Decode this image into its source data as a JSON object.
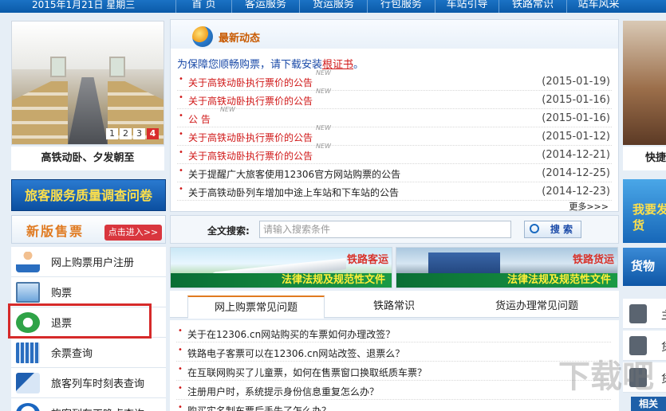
{
  "topbar": {
    "date": "2015年1月21日 星期三",
    "nav": [
      "首 页",
      "客运服务",
      "货运服务",
      "行包服务",
      "车站引导",
      "铁路常识",
      "站车风采"
    ]
  },
  "slider": {
    "pages": [
      "1",
      "2",
      "3",
      "4"
    ],
    "active_page": "4",
    "caption": "高铁动卧、夕发朝至"
  },
  "survey_banner": "旅客服务质量调查问卷",
  "new_ticket": {
    "title": "新版售票",
    "enter": "点击进入>>"
  },
  "left_menu": [
    {
      "label": "网上购票用户注册",
      "icon": "user-register-icon"
    },
    {
      "label": "购票",
      "icon": "computer-icon"
    },
    {
      "label": "退票",
      "icon": "return-arrow-icon"
    },
    {
      "label": "余票查询",
      "icon": "ticket-icon"
    },
    {
      "label": "旅客列车时刻表查询",
      "icon": "train-icon"
    },
    {
      "label": "旅客列车正晚点查询",
      "icon": "clock-icon"
    }
  ],
  "news": {
    "title": "最新动态",
    "notice_prefix": "为保障您顺畅购票，请下载安装",
    "notice_link": "根证书",
    "notice_suffix": "。",
    "items": [
      {
        "text": "关于高铁动卧执行票价的公告",
        "new": "NEW",
        "date": "(2015-01-19)",
        "color": "#d01818"
      },
      {
        "text": "关于高铁动卧执行票价的公告",
        "new": "NEW",
        "date": "(2015-01-16)",
        "color": "#d01818"
      },
      {
        "text": "公 告",
        "new": "NEW",
        "date": "(2015-01-16)",
        "color": "#d01818"
      },
      {
        "text": "关于高铁动卧执行票价的公告",
        "new": "NEW",
        "date": "(2015-01-12)",
        "color": "#d01818"
      },
      {
        "text": "关于高铁动卧执行票价的公告",
        "new": "NEW",
        "date": "(2014-12-21)",
        "color": "#d01818"
      },
      {
        "text": "关于提醒广大旅客使用12306官方网站购票的公告",
        "new": "",
        "date": "(2014-12-25)",
        "color": "#222222"
      },
      {
        "text": "关于高铁动卧列车增加中途上车站和下车站的公告",
        "new": "",
        "date": "(2014-12-23)",
        "color": "#222222"
      }
    ],
    "more": "更多>>>"
  },
  "search": {
    "label": "全文搜索:",
    "placeholder": "请输入搜索条件",
    "button": "搜 索"
  },
  "banners": [
    {
      "tag": "铁路客运",
      "strip": "法律法规及规范性文件"
    },
    {
      "tag": "铁路货运",
      "strip": "法律法规及规范性文件"
    }
  ],
  "faq": {
    "tabs": [
      "网上购票常见问题",
      "铁路常识",
      "货运办理常见问题"
    ],
    "active_tab": "网上购票常见问题",
    "items": [
      "关于在12306.cn网站购买的车票如何办理改签？",
      "铁路电子客票可以在12306.cn网站改签、退票么？",
      "在互联网购买了儿童票，如何在售票窗口换取纸质车票？",
      "注册用户时，系统提示身份信息重复怎么办？",
      "购买实名制车票后丢失了怎么办？"
    ]
  },
  "right": {
    "caption": "快捷",
    "blue1": "我要发货",
    "blue2": "货物",
    "items": [
      "主",
      "货",
      "货"
    ],
    "button": "相关"
  },
  "watermark": "下载吧",
  "colors": {
    "nav": "#0a5aa8",
    "highlight": "#d62a2a",
    "accent": "#e07a20"
  }
}
